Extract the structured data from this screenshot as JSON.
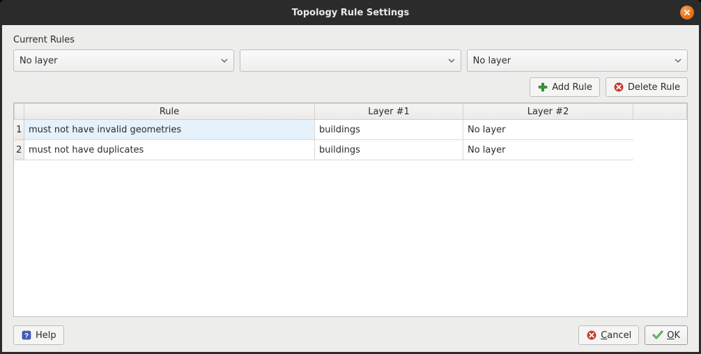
{
  "window": {
    "title": "Topology Rule Settings"
  },
  "body": {
    "section_label": "Current Rules"
  },
  "combos": {
    "layer1": "No layer",
    "rule": "",
    "layer2": "No layer"
  },
  "actions": {
    "add": "Add Rule",
    "delete": "Delete Rule"
  },
  "table": {
    "headers": {
      "rule": "Rule",
      "layer1": "Layer #1",
      "layer2": "Layer #2"
    },
    "rows": [
      {
        "n": "1",
        "rule": "must not have invalid geometries",
        "layer1": "buildings",
        "layer2": "No layer",
        "selected": true
      },
      {
        "n": "2",
        "rule": "must not have duplicates",
        "layer1": "buildings",
        "layer2": "No layer",
        "selected": false
      }
    ]
  },
  "footer": {
    "help": "Help",
    "cancel_pre": "",
    "cancel_u": "C",
    "cancel_post": "ancel",
    "ok_pre": "",
    "ok_u": "O",
    "ok_post": "K"
  }
}
